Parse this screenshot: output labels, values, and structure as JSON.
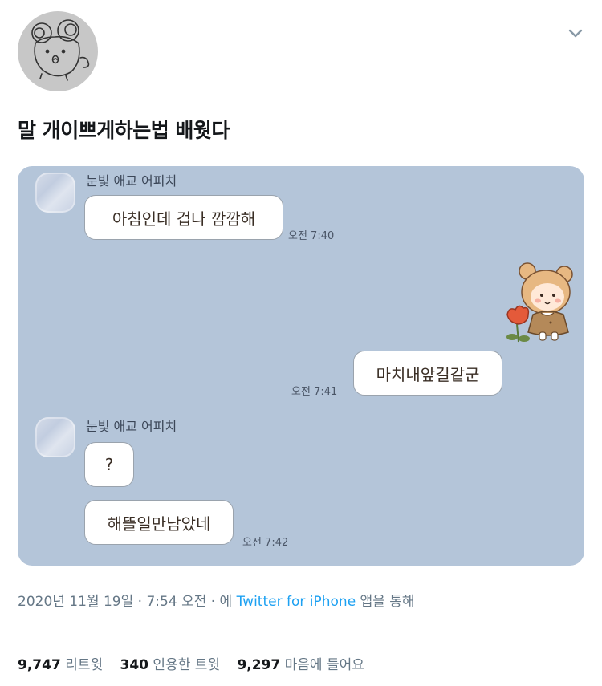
{
  "tweet": {
    "text": "말 개이쁘게하는법 배웟다",
    "date": "2020년 11월 19일",
    "sep1": " · ",
    "time": "7:54 오전",
    "sep2": " · 에 ",
    "source": "Twitter for iPhone",
    "source_suffix": " 앱을 통해"
  },
  "chat": {
    "sender_name_1": "눈빛 애교 어피치",
    "msg_1": "아침인데 겁나 깜깜해",
    "time_1": "오전 7:40",
    "reply": "마치내앞길같군",
    "time_2": "오전 7:41",
    "sender_name_2": "눈빛 애교 어피치",
    "msg_2": "?",
    "msg_3": "해뜰일만남았네",
    "time_3": "오전 7:42"
  },
  "stats": {
    "retweets_count": "9,747",
    "retweets_label": "리트윗",
    "quotes_count": "340",
    "quotes_label": "인용한 트윗",
    "likes_count": "9,297",
    "likes_label": "마음에 들어요"
  },
  "icons": {
    "menu": "chevron-down-icon",
    "avatar": "mouse-doodle-avatar"
  }
}
